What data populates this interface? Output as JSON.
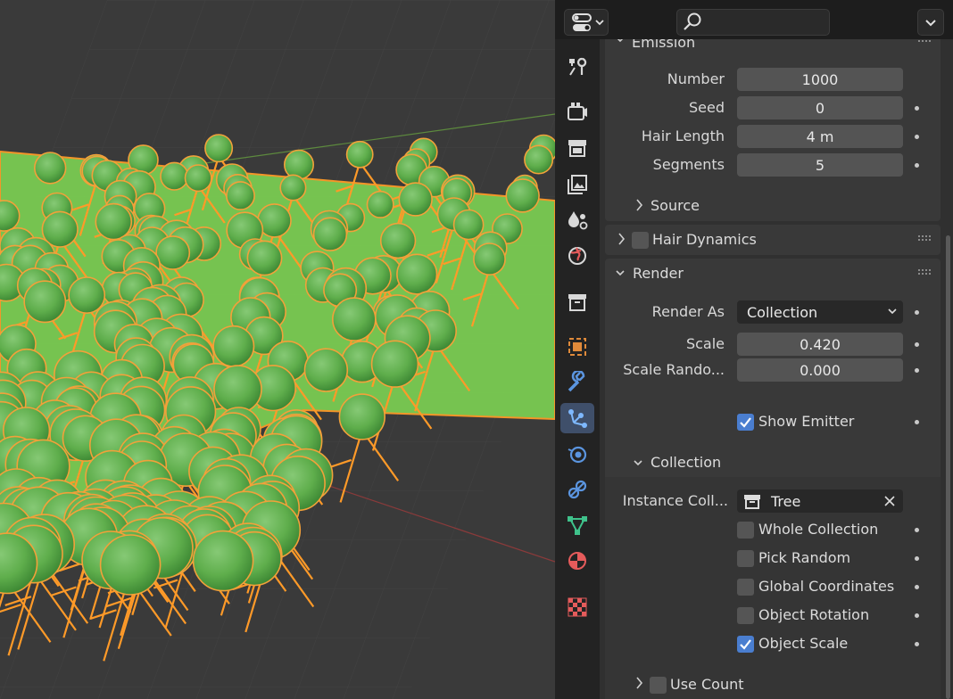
{
  "colors": {
    "accent_blue": "#4a7ed0",
    "active_tab": "#3f4f6a",
    "panel_bg": "#393939",
    "field_bg": "#545454",
    "selection_orange": "#ff9a28",
    "foliage_green": "#5fae4c"
  },
  "header": {
    "editor_type_icon": "properties-editor-icon",
    "search_icon": "search-icon",
    "options_icon": "chevron-down-icon"
  },
  "tabs": [
    {
      "icon": "tool-icon",
      "active": false
    },
    {
      "icon": "render-icon",
      "active": false
    },
    {
      "icon": "output-icon",
      "active": false
    },
    {
      "icon": "view-layer-icon",
      "active": false
    },
    {
      "icon": "scene-icon",
      "active": false
    },
    {
      "icon": "world-icon",
      "active": false
    },
    {
      "icon": "collection-icon",
      "active": false
    },
    {
      "icon": "object-icon",
      "active": false
    },
    {
      "icon": "modifier-icon",
      "active": false
    },
    {
      "icon": "particles-icon",
      "active": true
    },
    {
      "icon": "physics-icon",
      "active": false
    },
    {
      "icon": "constraints-icon",
      "active": false
    },
    {
      "icon": "data-icon",
      "active": false
    },
    {
      "icon": "material-icon",
      "active": false
    },
    {
      "icon": "texture-icon",
      "active": false
    }
  ],
  "emission": {
    "title": "Emission",
    "number_label": "Number",
    "number_value": "1000",
    "seed_label": "Seed",
    "seed_value": "0",
    "hair_length_label": "Hair Length",
    "hair_length_value": "4 m",
    "segments_label": "Segments",
    "segments_value": "5",
    "source_label": "Source"
  },
  "hair_dynamics": {
    "title": "Hair Dynamics",
    "enabled": false
  },
  "render": {
    "title": "Render",
    "render_as_label": "Render As",
    "render_as_value": "Collection",
    "scale_label": "Scale",
    "scale_value": "0.420",
    "scale_random_label": "Scale Rando...",
    "scale_random_value": "0.000",
    "show_emitter_label": "Show Emitter",
    "show_emitter": true
  },
  "collection": {
    "title": "Collection",
    "instance_label": "Instance Coll...",
    "instance_value": "Tree",
    "whole_collection_label": "Whole Collection",
    "whole_collection": false,
    "pick_random_label": "Pick Random",
    "pick_random": false,
    "global_coords_label": "Global Coordinates",
    "global_coords": false,
    "object_rotation_label": "Object Rotation",
    "object_rotation": false,
    "object_scale_label": "Object Scale",
    "object_scale": true,
    "use_count_label": "Use Count",
    "use_count": false
  }
}
